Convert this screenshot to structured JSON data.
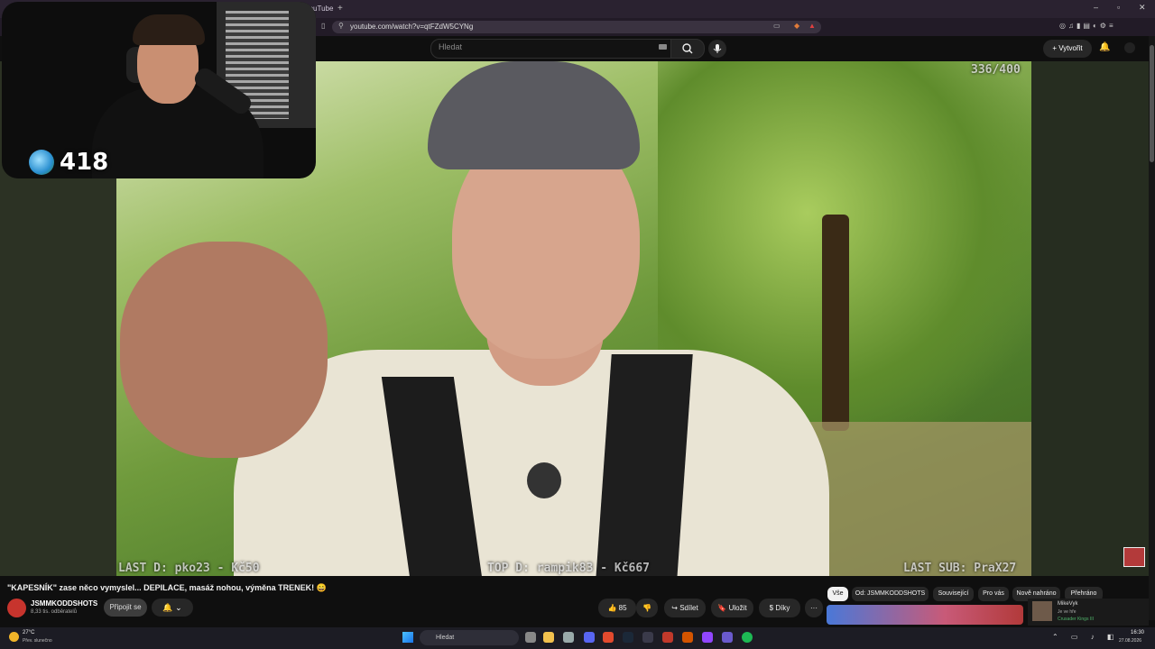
{
  "browser": {
    "tab_title": "YouTube",
    "new_tab": "+",
    "url": "youtube.com/watch?v=qtFZdW5CYNg",
    "window_controls": [
      "–",
      "▫",
      "✕"
    ]
  },
  "youtube": {
    "search_placeholder": "Hledat",
    "create_label": "+ Vytvořit"
  },
  "overlay": {
    "counter": "336/400",
    "last_donation": "LAST D: pko23 - Kč50",
    "top_donation": "TOP D: rampik83 - Kč667",
    "last_sub": "LAST SUB: PraX27"
  },
  "webcam": {
    "viewer_count": "418"
  },
  "video": {
    "title": "\"KAPESNÍK\" zase něco vymyslel... DEPILACE, masáž nohou, výměna TRENEK! 😄",
    "channel_name": "JSMMKODDSHOTS",
    "subscribers": "8,33 tis. odběratelů",
    "join_label": "Připojit se",
    "bell_label": "🔔 ⌄",
    "like_label": "👍 85",
    "dislike_label": "👎",
    "share_label": "↪ Sdílet",
    "save_label": "🔖 Uložit",
    "thanks_label": "$ Díky",
    "more_label": "···"
  },
  "chips": [
    "Vše",
    "Od: JSMMKODDSHOTS",
    "Související",
    "Pro vás",
    "Nově nahráno",
    "Přehráno"
  ],
  "live": {
    "name": "MikeVyk",
    "status": "Je ve hře",
    "game": "Crusader Kings III"
  },
  "taskbar": {
    "temperature": "27°C",
    "weather": "Přev. slunečno",
    "search": "Hledat",
    "time": "16:30",
    "date": "27.08.2026"
  },
  "colors": {
    "accent": "#f1f1f1",
    "chip_bg": "#272727",
    "channel_avatar": "#c7342d"
  }
}
